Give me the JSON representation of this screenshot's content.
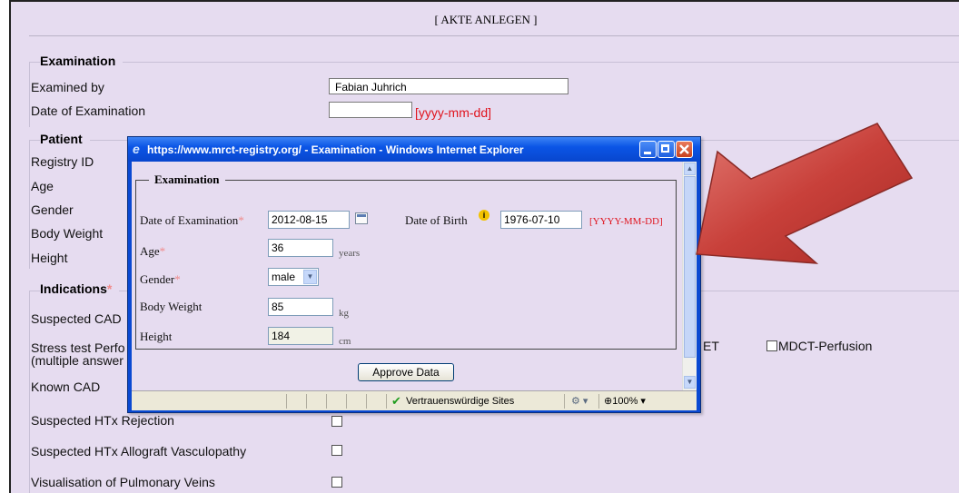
{
  "header": {
    "title": "[ AKTE ANLEGEN ]"
  },
  "examination": {
    "legend": "Examination",
    "examined_by_label": "Examined by",
    "examined_by_value": "Fabian Juhrich",
    "date_label": "Date of Examination",
    "date_value": "",
    "date_hint": "[yyyy-mm-dd]"
  },
  "patient": {
    "legend": "Patient",
    "registry_id_label": "Registry ID",
    "age_label": "Age",
    "gender_label": "Gender",
    "body_weight_label": "Body Weight",
    "height_label": "Height"
  },
  "indications": {
    "legend": "Indications",
    "required_mark": "*",
    "suspected_cad": "Suspected CAD",
    "stress_test_line1": "Stress test Perfo",
    "stress_test_line2": "(multiple answer",
    "option_et": "ET",
    "option_mdct": "MDCT-Perfusion",
    "known_cad": "Known CAD",
    "htx_rejection": "Suspected HTx Rejection",
    "htx_vasculopathy": "Suspected HTx Allograft Vasculopathy",
    "pulmonary_veins": "Visualisation of Pulmonary Veins"
  },
  "popup": {
    "title": "https://www.mrct-registry.org/ - Examination - Windows Internet Explorer",
    "legend": "Examination",
    "required_mark": "*",
    "date_label": "Date of Examination",
    "date_value": "2012-08-15",
    "dob_label": "Date of Birth",
    "dob_value": "1976-07-10",
    "dob_hint": "[YYYY-MM-DD]",
    "age_label": "Age",
    "age_value": "36",
    "age_unit": "years",
    "gender_label": "Gender",
    "gender_value": "male",
    "weight_label": "Body Weight",
    "weight_value": "85",
    "weight_unit": "kg",
    "height_label": "Height",
    "height_value": "184",
    "height_unit": "cm",
    "approve_label": "Approve Data",
    "status_zone": "Vertrauenswürdige Sites",
    "zoom": "100%"
  },
  "colors": {
    "page_bg": "#e6dcf0",
    "titlebar": "#0b55e6",
    "hint_red": "#e0141e",
    "arrow_red": "#c0403a"
  }
}
